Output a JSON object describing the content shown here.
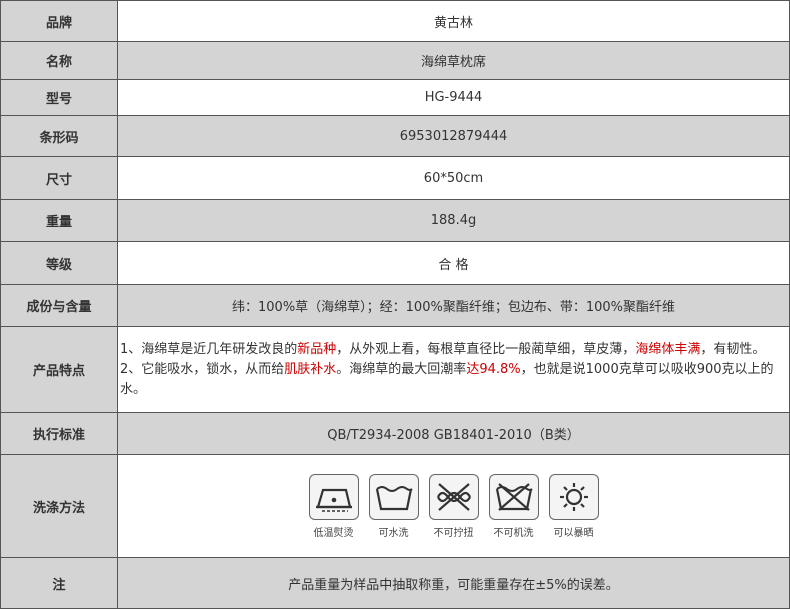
{
  "rows": [
    {
      "label": "品牌",
      "value": "黄古林"
    },
    {
      "label": "名称",
      "value": "海绵草枕席"
    },
    {
      "label": "型号",
      "value": "HG-9444"
    },
    {
      "label": "条形码",
      "value": "6953012879444"
    },
    {
      "label": "尺寸",
      "value": "60*50cm"
    },
    {
      "label": "重量",
      "value": "188.4g"
    },
    {
      "label": "等级",
      "value": "合 格"
    },
    {
      "label": "成份与含量",
      "value": "纬：100%草（海绵草）；经：100%聚酯纤维；包边布、带：100%聚酯纤维"
    }
  ],
  "features": {
    "label": "产品特点",
    "line1_a": "1、海绵草是近几年研发改良的",
    "line1_hl1": "新品种",
    "line1_b": "，从外观上看，每根草直径比一般蔺草细，草皮薄，",
    "line1_hl2": "海绵体丰满",
    "line1_c": "，有韧性。",
    "line2_a": "2、它能吸水，锁水，从而给",
    "line2_hl1": "肌肤补水",
    "line2_b": "。海绵草的最大回潮率",
    "line2_hl2": "达94.8%",
    "line2_c": "，也就是说1000克草可以吸收900克以上的水。"
  },
  "standard": {
    "label": "执行标准",
    "value": "QB/T2934-2008 GB18401-2010（B类）"
  },
  "washing": {
    "label": "洗涤方法",
    "icons": [
      {
        "name": "low-temp-iron",
        "caption": "低温熨烫"
      },
      {
        "name": "hand-washable",
        "caption": "可水洗"
      },
      {
        "name": "no-wring",
        "caption": "不可拧扭"
      },
      {
        "name": "no-machine-wash",
        "caption": "不可机洗"
      },
      {
        "name": "sun-dry",
        "caption": "可以暴晒"
      }
    ]
  },
  "note": {
    "label": "注",
    "value": "产品重量为样品中抽取称重，可能重量存在±5%的误差。"
  }
}
